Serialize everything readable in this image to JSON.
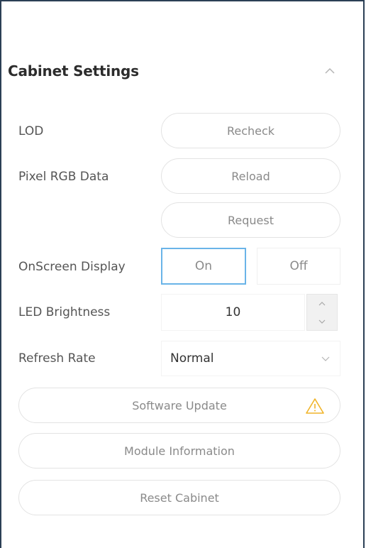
{
  "section": {
    "title": "Cabinet Settings"
  },
  "rows": {
    "lod": {
      "label": "LOD",
      "button": "Recheck"
    },
    "pixel_rgb": {
      "label": "Pixel RGB Data",
      "reload": "Reload",
      "request": "Request"
    },
    "osd": {
      "label": "OnScreen Display",
      "on": "On",
      "off": "Off",
      "selected": "On"
    },
    "brightness": {
      "label": "LED Brightness",
      "value": "10"
    },
    "refresh": {
      "label": "Refresh Rate",
      "value": "Normal"
    }
  },
  "actions": {
    "software_update": "Software Update",
    "module_information": "Module Information",
    "reset_cabinet": "Reset Cabinet"
  },
  "icons": {
    "collapse": "chevron-up-icon",
    "warning": "warning-triangle-icon",
    "dropdown": "chevron-down-icon"
  },
  "colors": {
    "active_border": "#6ab4e8",
    "warning": "#f0b429",
    "frame": "#2b3f55"
  }
}
